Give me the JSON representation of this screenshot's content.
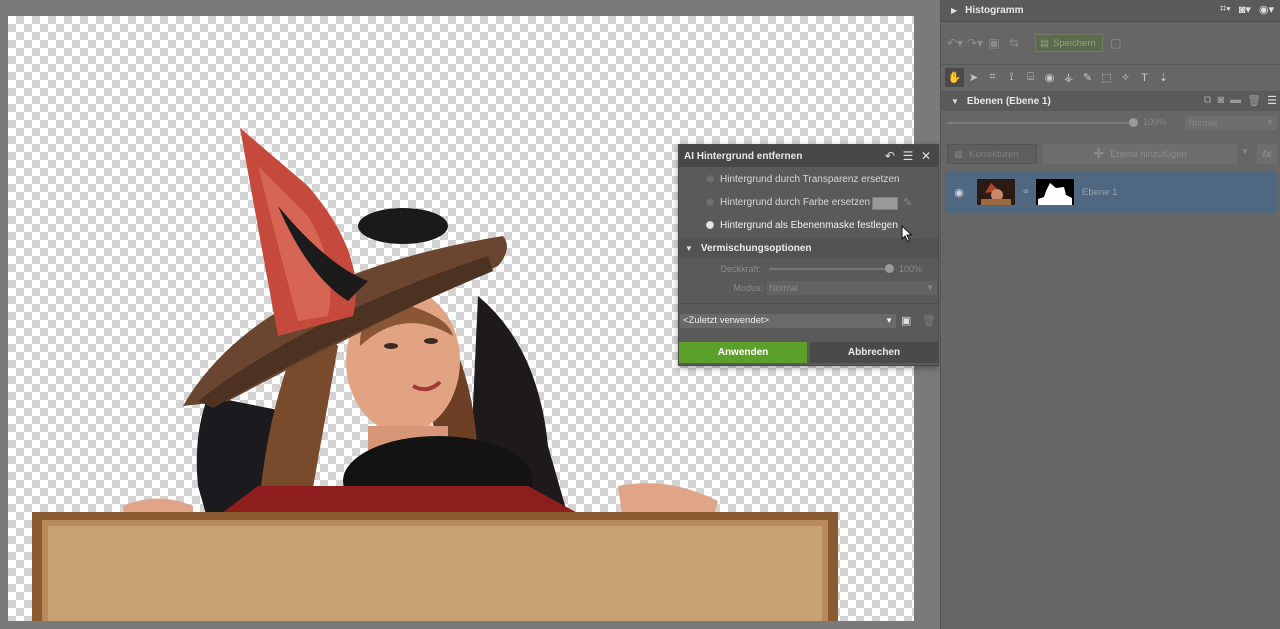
{
  "right_panel": {
    "histogram_title": "Histogramm",
    "save_label": "Speichern",
    "layers_title": "Ebenen (Ebene 1)",
    "layer_opacity": "100%",
    "layer_mode": "Normal",
    "corrections_label": "Korrekturen",
    "add_layer_label": "Ebene hinzufügen",
    "fx_label": "fx",
    "layer": {
      "name": "Ebene 1",
      "opacity_fraction": 1.0
    }
  },
  "dialog": {
    "title": "AI Hintergrund entfernen",
    "options": [
      {
        "label": "Hintergrund durch Transparenz ersetzen",
        "checked": false
      },
      {
        "label": "Hintergrund durch Farbe ersetzen",
        "checked": false
      },
      {
        "label": "Hintergrund als Ebenenmaske festlegen",
        "checked": true
      }
    ],
    "blend_title": "Vermischungsoptionen",
    "opacity_label": "Deckkraft:",
    "opacity_value": "100%",
    "opacity_fraction": 1.0,
    "mode_label": "Modus:",
    "mode_value": "Normal",
    "preset_value": "<Zuletzt verwendet>",
    "apply_label": "Anwenden",
    "cancel_label": "Abbrechen"
  },
  "colors": {
    "apply_green": "#5c9f2b",
    "selected_layer": "#4f6780",
    "panel_bg": "#666666"
  }
}
